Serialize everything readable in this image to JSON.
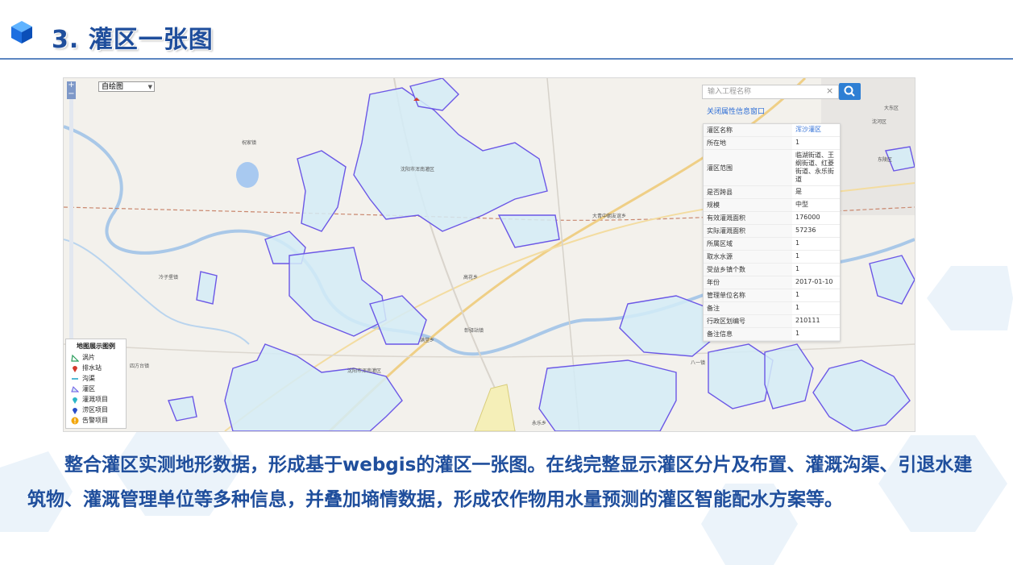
{
  "slide": {
    "title": "3. 灌区一张图",
    "body": "整合灌区实测地形数据，形成基于webgis的灌区一张图。在线完整显示灌区分片及布置、灌溉沟渠、引退水建筑物、灌溉管理单位等多种信息，并叠加墒情数据，形成农作物用水量预测的灌区智能配水方案等。"
  },
  "colors": {
    "title": "#1f4e9c",
    "irrigation_area_fill": "#d4ecf7",
    "irrigation_area_stroke": "#6b57e6",
    "link": "#2e6ed6",
    "search_button": "#2e7fd4"
  },
  "map": {
    "zoom_in": "+",
    "zoom_out": "−",
    "basemap_select": "自绘图",
    "search_placeholder": "输入工程名称",
    "search_icon": "search-icon",
    "close_info_link": "关闭属性信息窗口",
    "attributes": [
      {
        "key": "灌区名称",
        "value": "浑沙灌区"
      },
      {
        "key": "所在地",
        "value": "1"
      },
      {
        "key": "灌区范围",
        "value": "临湖街道、王纲街道、红菱街道、永乐街道"
      },
      {
        "key": "是否跨县",
        "value": "是"
      },
      {
        "key": "规模",
        "value": "中型"
      },
      {
        "key": "有效灌溉面积",
        "value": "176000"
      },
      {
        "key": "实际灌溉面积",
        "value": "57236"
      },
      {
        "key": "所属区域",
        "value": "1"
      },
      {
        "key": "取水水源",
        "value": "1"
      },
      {
        "key": "受益乡镇个数",
        "value": "1"
      },
      {
        "key": "年份",
        "value": "2017-01-10"
      },
      {
        "key": "管理单位名称",
        "value": "1"
      },
      {
        "key": "备注",
        "value": "1"
      },
      {
        "key": "行政区划编号",
        "value": "210111"
      },
      {
        "key": "备注信息",
        "value": "1"
      }
    ],
    "legend": {
      "title": "地图展示图例",
      "items": [
        {
          "label": "涡片",
          "icon": "triangle-outline-icon",
          "color": "#2a9d5c"
        },
        {
          "label": "排水站",
          "icon": "map-pin-icon",
          "color": "#d33a2c"
        },
        {
          "label": "沟渠",
          "icon": "line-icon",
          "color": "#1ba1c6"
        },
        {
          "label": "灌区",
          "icon": "polygon-icon",
          "color": "#6b57e6"
        },
        {
          "label": "灌溉项目",
          "icon": "map-pin-icon",
          "color": "#2bb6c8"
        },
        {
          "label": "涝区项目",
          "icon": "map-pin-icon",
          "color": "#2a4ec9"
        },
        {
          "label": "告警项目",
          "icon": "alert-icon",
          "color": "#f2a60c"
        }
      ]
    },
    "place_labels": [
      "沈阳市浑南灌区",
      "沈阳市浑南灌区",
      "大东区",
      "沈河区",
      "东陵区",
      "大青中朝友谊乡",
      "高花乡",
      "满堂乡",
      "彰驿站镇",
      "永乐乡",
      "八一镇",
      "冷子堡镇",
      "四方台镇",
      "祝家镇"
    ]
  }
}
